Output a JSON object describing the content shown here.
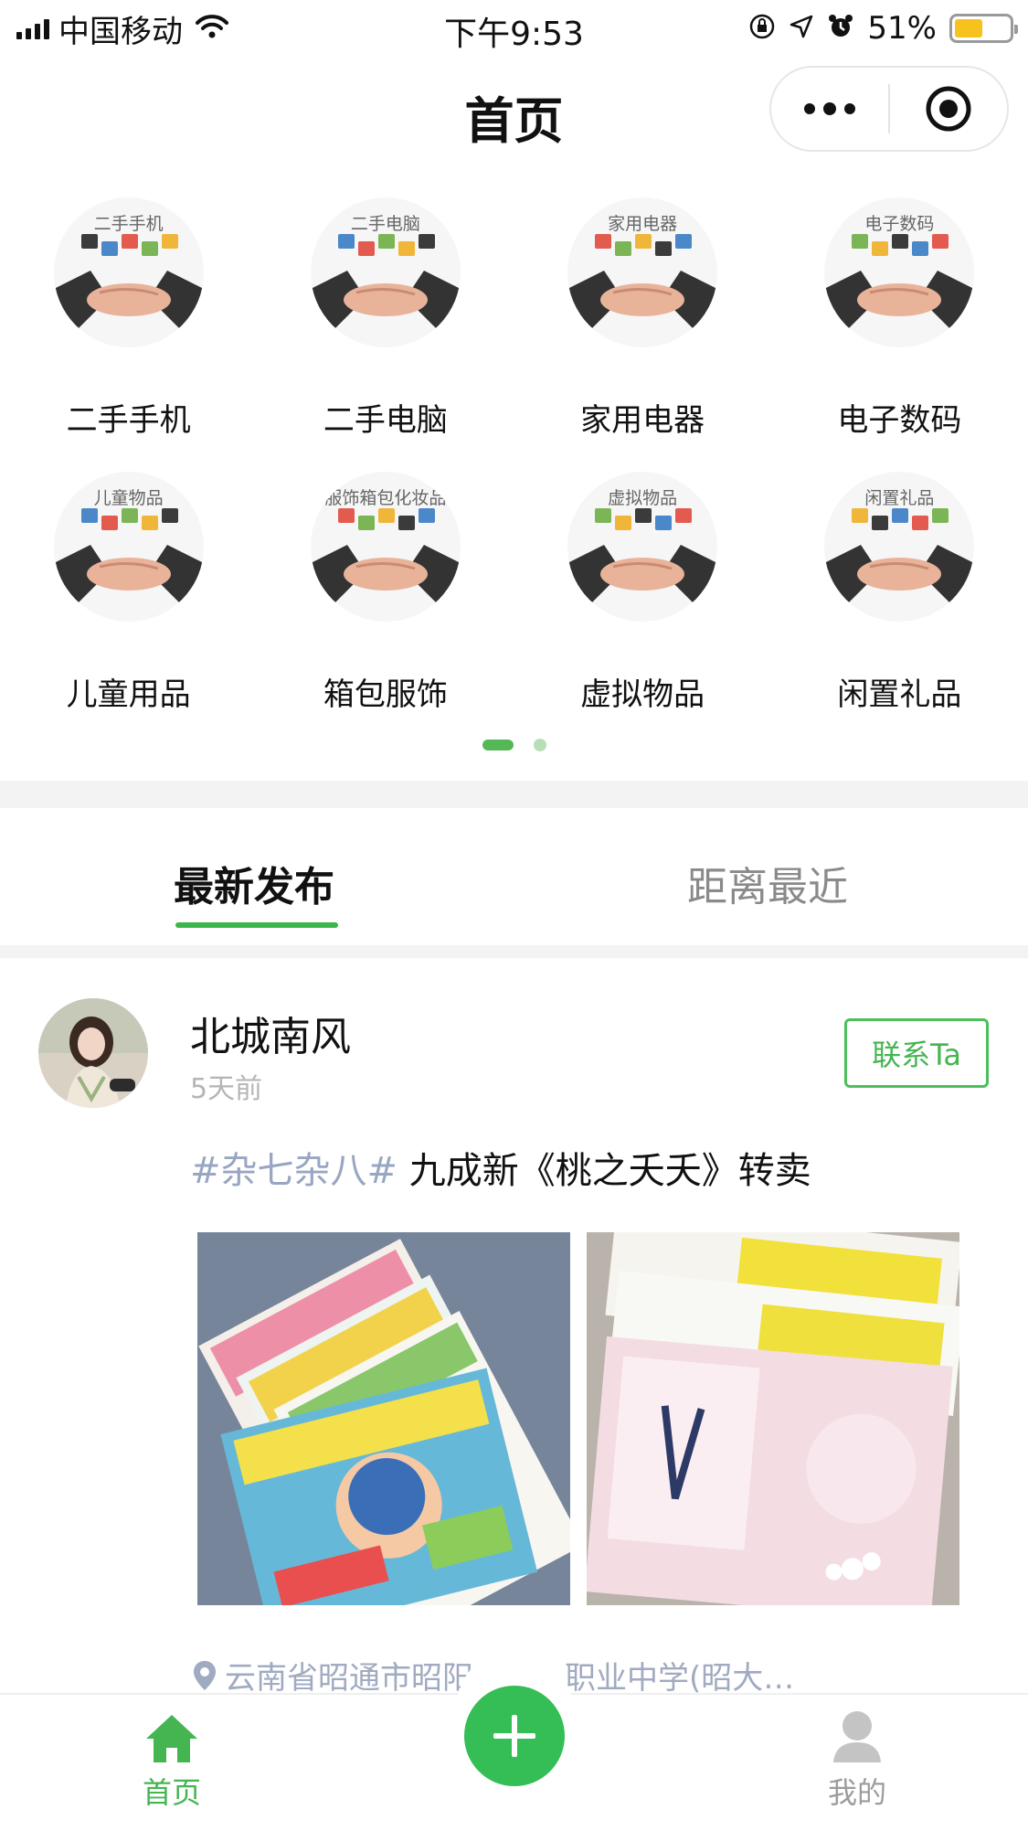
{
  "status_bar": {
    "carrier": "中国移动",
    "time": "下午9:53",
    "battery_percent": "51%",
    "battery_level": 0.51
  },
  "nav": {
    "title": "首页"
  },
  "categories": {
    "rows": [
      [
        {
          "caption": "二手手机",
          "label": "二手手机"
        },
        {
          "caption": "二手电脑",
          "label": "二手电脑"
        },
        {
          "caption": "家用电器",
          "label": "家用电器"
        },
        {
          "caption": "电子数码",
          "label": "电子数码"
        }
      ],
      [
        {
          "caption": "儿童物品",
          "label": "儿童用品"
        },
        {
          "caption": "服饰箱包化妆品",
          "label": "箱包服饰"
        },
        {
          "caption": "虚拟物品",
          "label": "虚拟物品"
        },
        {
          "caption": "闲置礼品",
          "label": "闲置礼品"
        }
      ]
    ]
  },
  "tabs": {
    "latest": "最新发布",
    "nearest": "距离最近"
  },
  "post": {
    "username": "北城南风",
    "time": "5天前",
    "contact_label": "联系Ta",
    "tag": "#杂七杂八#",
    "text": " 九成新《桃之夭夭》转卖",
    "location": "云南省昭通市昭阳",
    "location_tail": "职业中学(昭大…"
  },
  "tabbar": {
    "home": "首页",
    "mine": "我的"
  },
  "colors": {
    "accent": "#35bd56",
    "tag": "#98a6c2"
  }
}
